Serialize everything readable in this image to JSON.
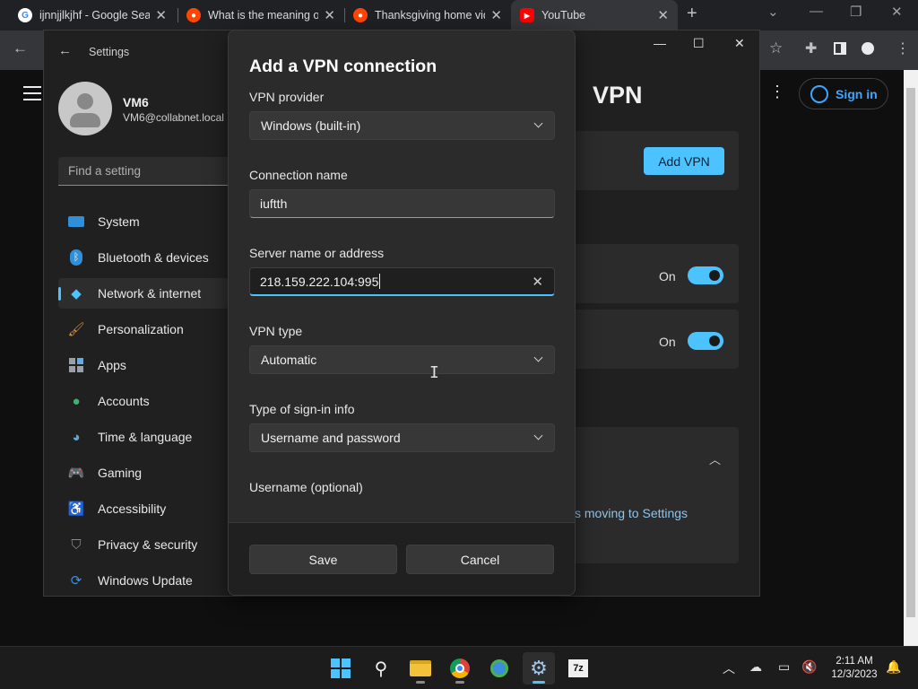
{
  "browser": {
    "tabs": [
      {
        "title": "ijnnjjlkjhf - Google Sear",
        "favicon": "google-icon"
      },
      {
        "title": "What is the meaning of",
        "favicon": "reddit-icon"
      },
      {
        "title": "Thanksgiving home vid",
        "favicon": "reddit-icon"
      },
      {
        "title": "YouTube",
        "favicon": "youtube-icon",
        "active": true
      }
    ]
  },
  "youtube": {
    "sign_in_label": "Sign in"
  },
  "settings": {
    "window_title": "Settings",
    "profile": {
      "name": "VM6",
      "email": "VM6@collabnet.local"
    },
    "search_placeholder": "Find a setting",
    "nav_items": [
      {
        "label": "System",
        "icon": "system-icon"
      },
      {
        "label": "Bluetooth & devices",
        "icon": "bluetooth-icon"
      },
      {
        "label": "Network & internet",
        "icon": "network-icon",
        "active": true
      },
      {
        "label": "Personalization",
        "icon": "brush-icon"
      },
      {
        "label": "Apps",
        "icon": "apps-icon"
      },
      {
        "label": "Accounts",
        "icon": "accounts-icon"
      },
      {
        "label": "Time & language",
        "icon": "globe-icon"
      },
      {
        "label": "Gaming",
        "icon": "gamepad-icon"
      },
      {
        "label": "Accessibility",
        "icon": "accessibility-icon"
      },
      {
        "label": "Privacy & security",
        "icon": "shield-icon"
      },
      {
        "label": "Windows Update",
        "icon": "update-icon"
      }
    ],
    "page_title": "VPN",
    "add_vpn_label": "Add VPN",
    "toggle_1_label": "On",
    "toggle_2_label": "On",
    "moving_text": "s moving to Settings"
  },
  "dialog": {
    "title": "Add a VPN connection",
    "vpn_provider": {
      "label": "VPN provider",
      "value": "Windows (built-in)"
    },
    "connection_name": {
      "label": "Connection name",
      "value": "iuftth"
    },
    "server": {
      "label": "Server name or address",
      "value": "218.159.222.104:995"
    },
    "vpn_type": {
      "label": "VPN type",
      "value": "Automatic"
    },
    "signin_type": {
      "label": "Type of sign-in info",
      "value": "Username and password"
    },
    "username": {
      "label": "Username (optional)"
    },
    "save_label": "Save",
    "cancel_label": "Cancel"
  },
  "taskbar": {
    "time": "2:11 AM",
    "date": "12/3/2023"
  },
  "colors": {
    "accent": "#4cc2ff",
    "dialog_bg": "#2b2b2b",
    "settings_bg": "#202020"
  }
}
